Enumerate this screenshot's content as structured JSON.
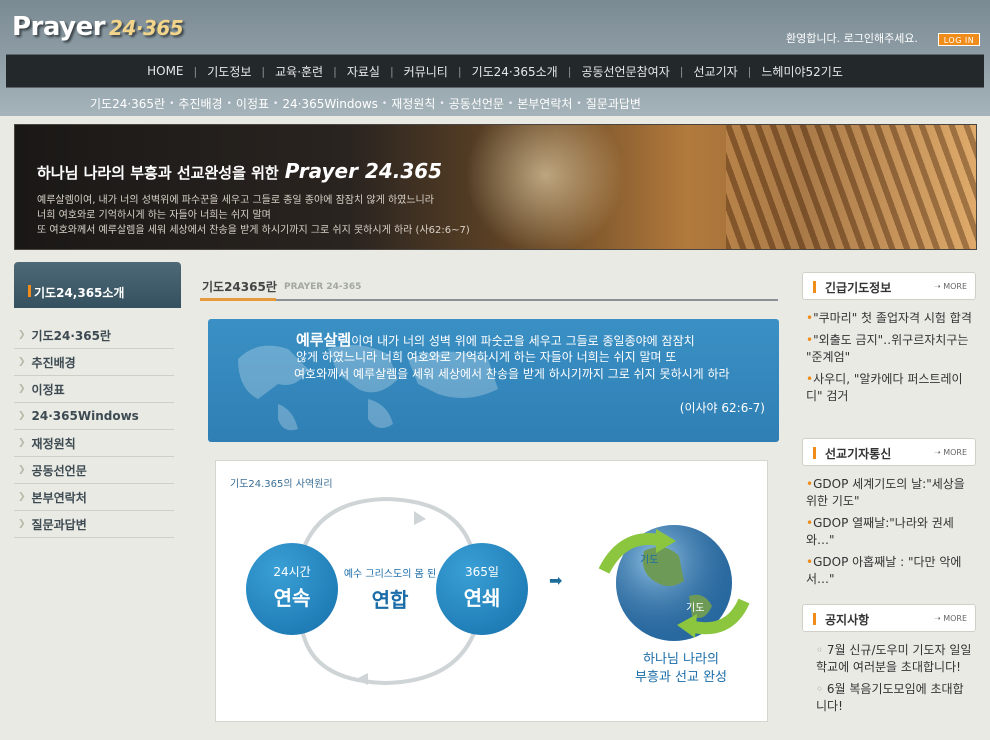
{
  "header": {
    "logo_main": "Prayer",
    "logo_num": "24·365",
    "welcome": "환영합니다. 로그인해주세요.",
    "login": "LOG IN"
  },
  "gnb": [
    "HOME",
    "기도정보",
    "교육·훈련",
    "자료실",
    "커뮤니티",
    "기도24·365소개",
    "공동선언문참여자",
    "선교기자",
    "느헤미야52기도"
  ],
  "subnav": [
    "기도24·365란",
    "추진배경",
    "이정표",
    "24·365Windows",
    "재정원칙",
    "공동선언문",
    "본부연락처",
    "질문과답변"
  ],
  "banner": {
    "title": "하나님 나라의 부흥과 선교완성을 위한",
    "brand": "Prayer 24.365",
    "lines": [
      "예루살렘이여, 내가 너의 성벽위에 파수꾼을 세우고 그들로 종일 종야에 잠잠치 않게 하였느니라",
      "너희 여호와로 기억하시게 하는 자들아 너희는 쉬지 말며",
      "또 여호와께서 예루살렘을 세워 세상에서 찬송을 받게 하시기까지 그로 쉬지 못하시게 하라 (사62:6~7)"
    ]
  },
  "left": {
    "title": "기도24,365소개",
    "items": [
      "기도24·365란",
      "추진배경",
      "이정표",
      "24·365Windows",
      "재정원칙",
      "공동선언문",
      "본부연락처",
      "질문과답변"
    ]
  },
  "main": {
    "title": "기도24365란",
    "subtitle": "PRAYER 24-365",
    "verse": {
      "lead": "예루살렘",
      "line1": "이여 내가 너의 성벽 위에 파숫군을 세우고 그들로 종일종야에 잠잠치",
      "line2": "않게 하였느니라 너희 여호와로  기억하시게 하는 자들아 너희는 쉬지 말며 또",
      "line3": "여호와께서 예루살렘을 세워 세상에서 찬송을 받게 하시기까지  그로 쉬지 못하시게 하라",
      "ref": "(이사야 62:6-7)"
    },
    "diagram": {
      "label": "기도24.365의 사역원리",
      "c1_small": "24시간",
      "c1_large": "연속",
      "mid_small": "예수 그리스도의 몸 된",
      "mid_large": "연합",
      "c2_small": "365일",
      "c2_large": "연쇄",
      "arrow1": "기도",
      "arrow2": "기도",
      "caption1": "하나님 나라의",
      "caption2": "부흥과 선교 완성"
    }
  },
  "right": {
    "urgent": {
      "title": "긴급기도정보",
      "more": "MORE",
      "items": [
        "\"쿠마리\" 첫 졸업자격 시험 합격",
        "\"외출도 금지\"‥위구르자치구는 \"준계엄\"",
        "사우디, \"알카에다 퍼스트레이디\" 검거"
      ]
    },
    "reporter": {
      "title": "선교기자통신",
      "more": "MORE",
      "items": [
        "GDOP 세계기도의 날:\"세상을 위한 기도\"",
        "GDOP 열째날:\"나라와 권세와…\"",
        "GDOP 아홉째날 : \"다만 악에서…\""
      ]
    },
    "notice": {
      "title": "공지사항",
      "more": "MORE",
      "items": [
        "7월 신규/도우미 기도자 일일학교에 여러분을 초대합니다!",
        "6월 복음기도모임에 초대합니다!"
      ]
    }
  }
}
